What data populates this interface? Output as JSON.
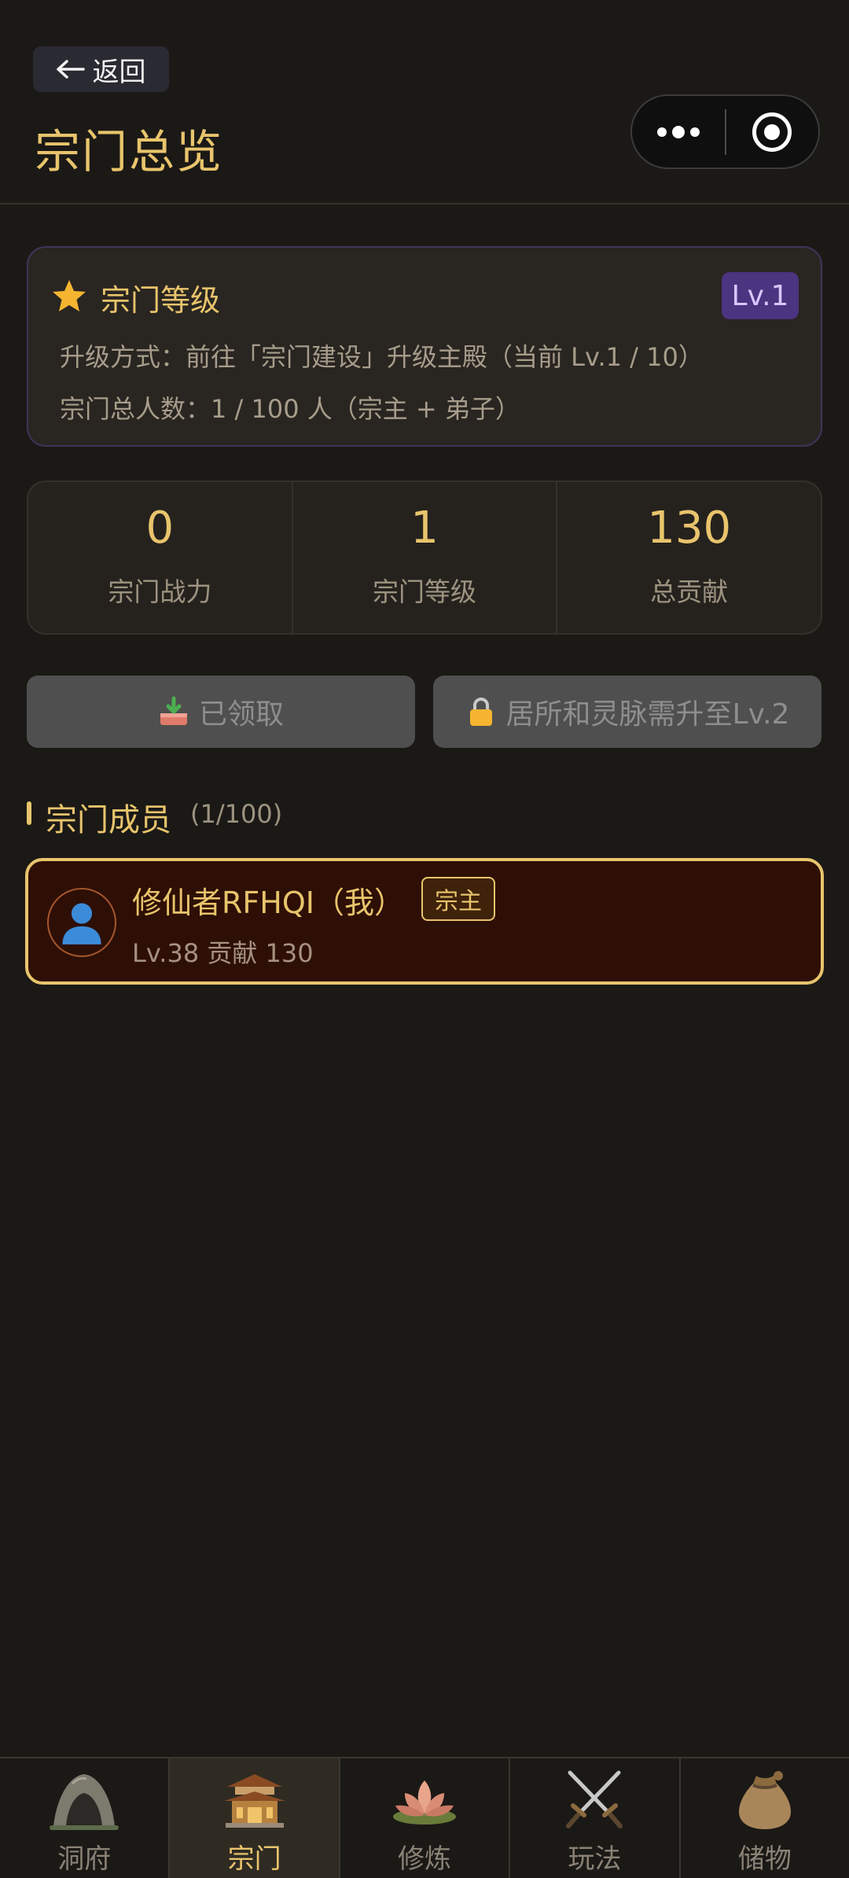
{
  "header": {
    "back_label": "返回",
    "page_title": "宗门总览"
  },
  "level_card": {
    "title": "宗门等级",
    "badge": "Lv.1",
    "upgrade_text": "升级方式：前往「宗门建设」升级主殿（当前 Lv.1 / 10）",
    "members_text": "宗门总人数：1 / 100 人（宗主 + 弟子）"
  },
  "stats": [
    {
      "value": "0",
      "label": "宗门战力"
    },
    {
      "value": "1",
      "label": "宗门等级"
    },
    {
      "value": "130",
      "label": "总贡献"
    }
  ],
  "actions": {
    "claim_label": "已领取",
    "lock_label": "居所和灵脉需升至Lv.2"
  },
  "members_section": {
    "title": "宗门成员",
    "count": "(1/100)",
    "items": [
      {
        "name": "修仙者RFHQI（我）",
        "role": "宗主",
        "meta": "Lv.38   贡献 130"
      }
    ]
  },
  "tabbar": {
    "tabs": [
      {
        "label": "洞府",
        "icon": "cave-icon"
      },
      {
        "label": "宗门",
        "icon": "temple-icon"
      },
      {
        "label": "修炼",
        "icon": "lotus-icon"
      },
      {
        "label": "玩法",
        "icon": "crossed-swords-icon"
      },
      {
        "label": "储物",
        "icon": "pouch-icon"
      }
    ],
    "active": "宗门"
  },
  "colors": {
    "background": "#1b1916",
    "accent_gold": "#e8c46c",
    "level_badge": "#4b3480",
    "member_card": "#2e0f05"
  }
}
